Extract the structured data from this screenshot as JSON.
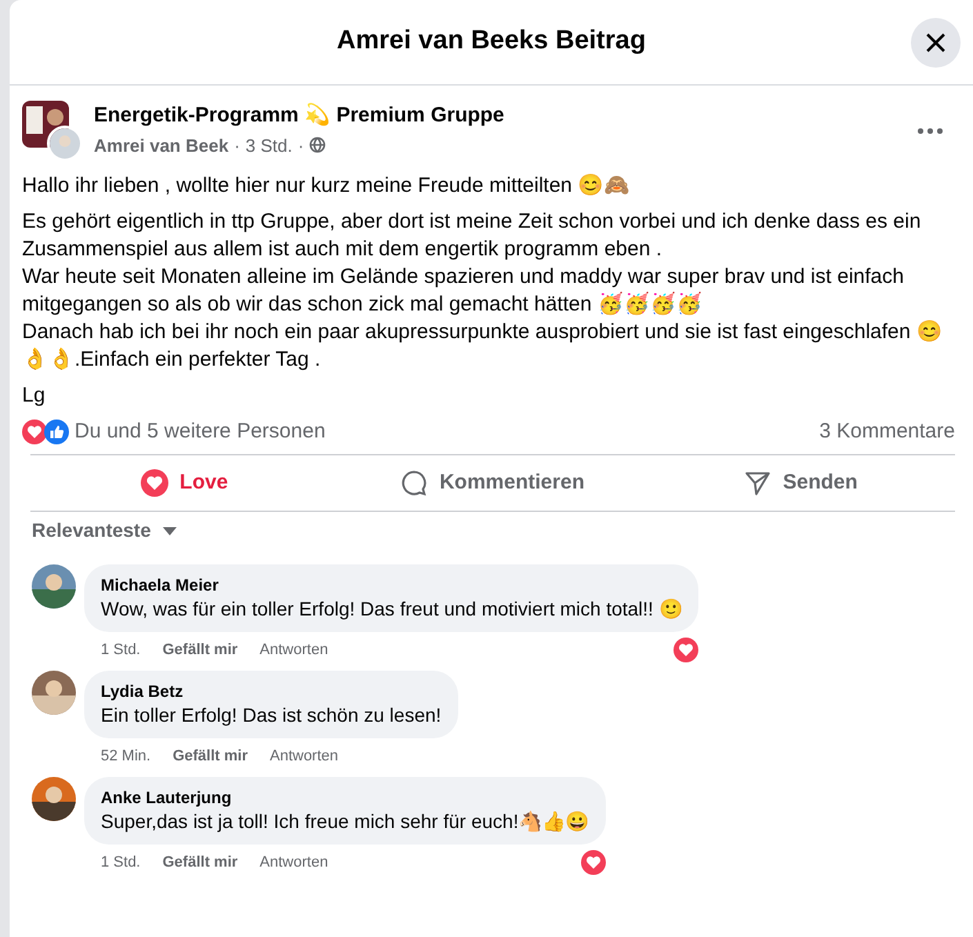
{
  "dialog": {
    "title": "Amrei van Beeks Beitrag"
  },
  "post": {
    "group": "Energetik-Programm 💫 Premium Gruppe",
    "author": "Amrei van Beek",
    "time": "3 Std.",
    "separator": "·",
    "paragraphs": [
      "Hallo ihr lieben , wollte hier nur kurz meine Freude mitteilten 😊🙈",
      "Es gehört  eigentlich in ttp Gruppe, aber dort ist meine Zeit schon vorbei und ich denke dass es ein Zusammenspiel aus allem ist auch mit dem engertik programm eben .\nWar heute seit Monaten alleine im Gelände  spazieren und maddy war super brav und ist einfach mitgegangen so als ob wir das schon zick mal gemacht hätten 🥳🥳🥳🥳\nDanach hab ich bei ihr noch ein paar akupressurpunkte ausprobiert und sie ist fast eingeschlafen 😊 👌👌.Einfach ein perfekter  Tag .",
      "Lg"
    ],
    "reactions": "Du und 5 weitere Personen",
    "comment_count": "3 Kommentare"
  },
  "actions": [
    {
      "kind": "love",
      "label": "Love",
      "selected": true
    },
    {
      "kind": "comment",
      "label": "Kommentieren",
      "selected": false
    },
    {
      "kind": "send",
      "label": "Senden",
      "selected": false
    }
  ],
  "sort": "Relevanteste",
  "comments": [
    {
      "name": "Michaela Meier",
      "text": "Wow, was für ein toller Erfolg! Das freut und motiviert mich total!! 🙂",
      "time": "1 Std.",
      "like": "Gefällt mir",
      "reply": "Antworten",
      "loved": true
    },
    {
      "name": "Lydia Betz",
      "text": "Ein toller Erfolg! Das ist schön zu lesen!",
      "time": "52 Min.",
      "like": "Gefällt mir",
      "reply": "Antworten",
      "loved": false
    },
    {
      "name": "Anke Lauterjung",
      "text": "Super,das ist ja toll! Ich freue mich sehr für euch!🐴👍😀",
      "time": "1 Std.",
      "like": "Gefällt mir",
      "reply": "Antworten",
      "loved": true
    }
  ]
}
